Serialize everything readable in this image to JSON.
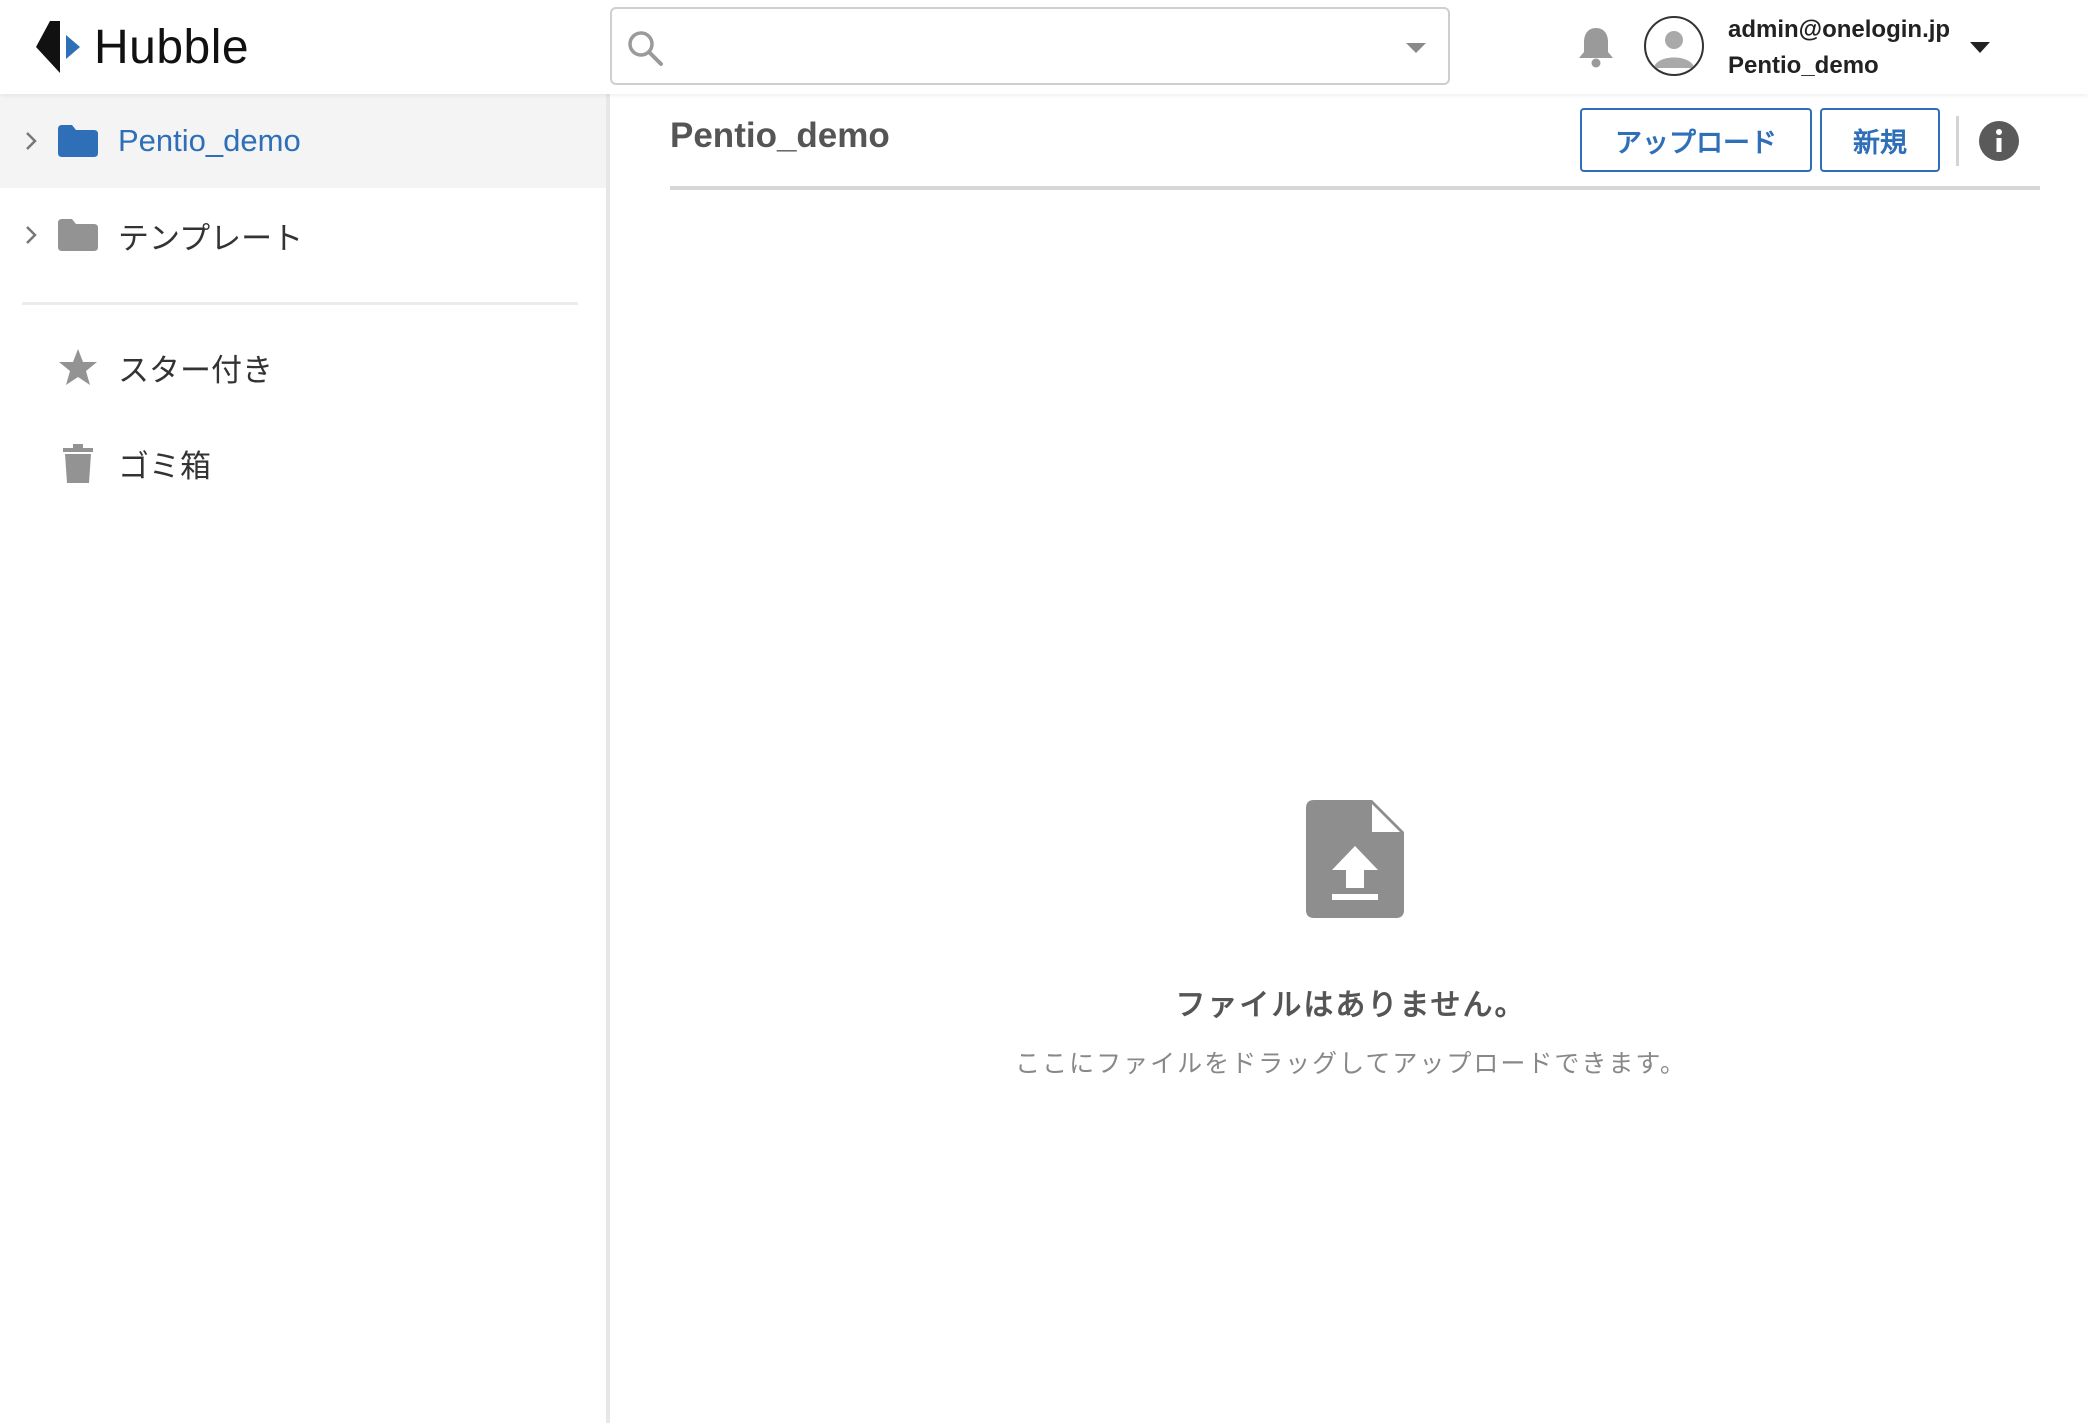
{
  "header": {
    "logo_text": "Hubble",
    "search": {
      "value": "",
      "placeholder": ""
    },
    "user": {
      "email": "admin@onelogin.jp",
      "organization": "Pentio_demo"
    }
  },
  "sidebar": {
    "tree": [
      {
        "label": "Pentio_demo",
        "active": true,
        "color": "#2f6fb8"
      },
      {
        "label": "テンプレート",
        "active": false,
        "color": "#333333"
      }
    ],
    "nav": [
      {
        "label": "スター付き",
        "icon": "star-icon"
      },
      {
        "label": "ゴミ箱",
        "icon": "trash-icon"
      }
    ]
  },
  "main": {
    "title": "Pentio_demo",
    "upload_label": "アップロード",
    "new_label": "新規",
    "empty": {
      "title": "ファイルはありません。",
      "subtitle": "ここにファイルをドラッグしてアップロードできます。"
    }
  },
  "colors": {
    "accent": "#2f6fb8",
    "icon_gray": "#8e8e8e",
    "active_bg": "#f4f4f4"
  }
}
